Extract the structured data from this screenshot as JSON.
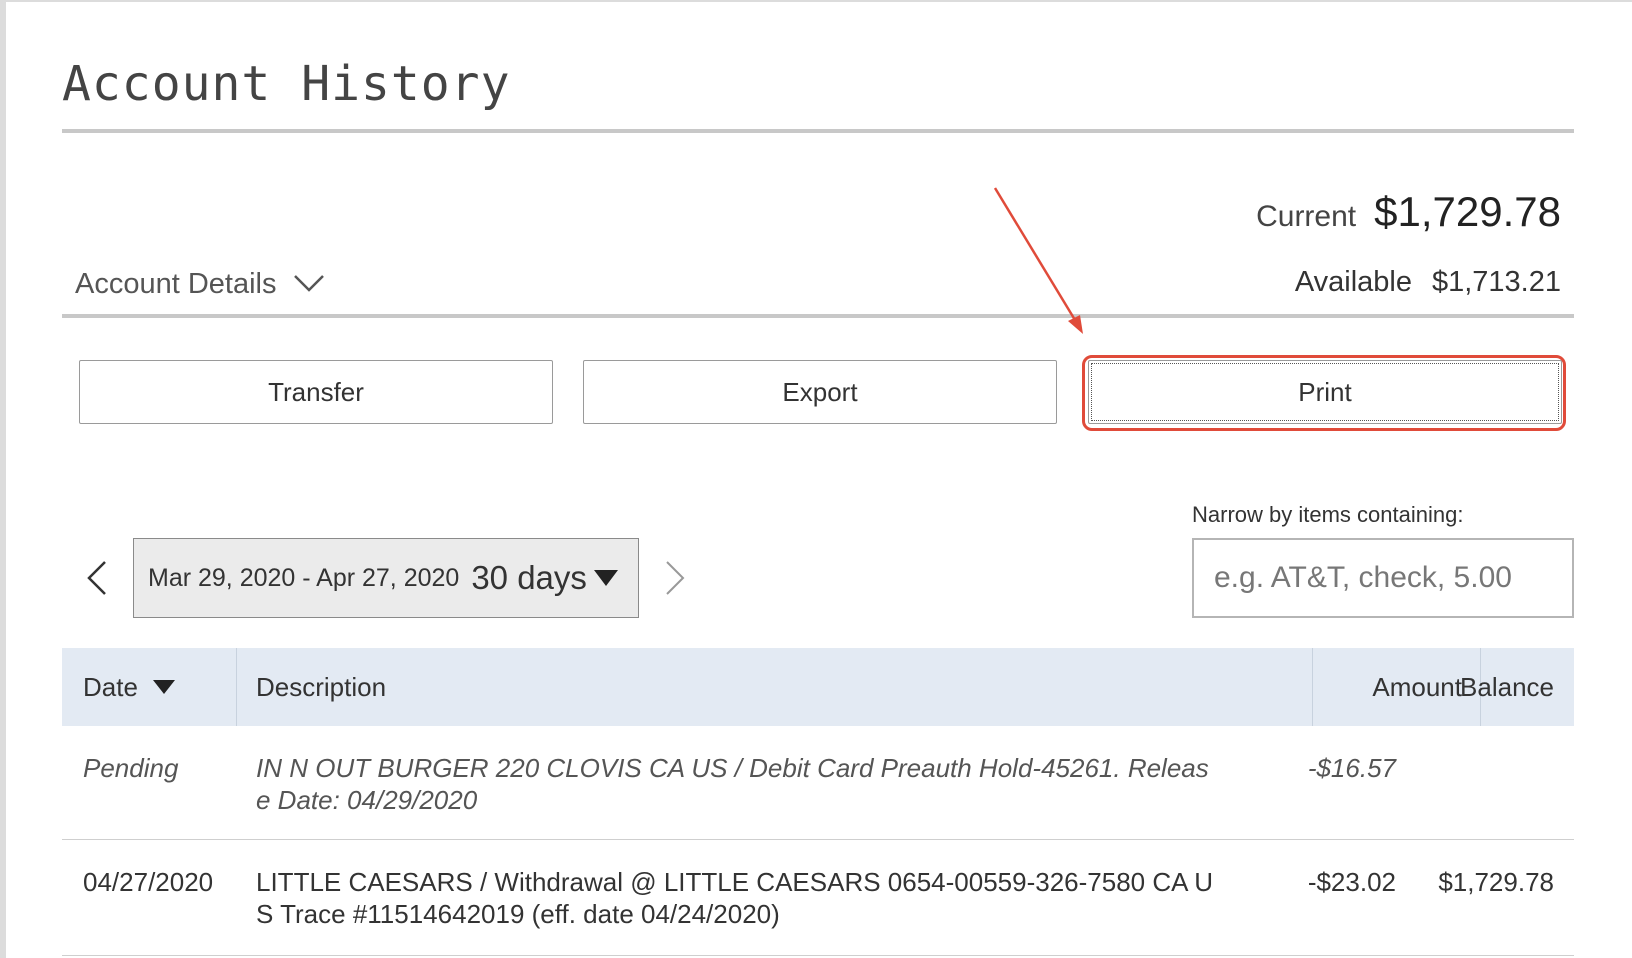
{
  "page": {
    "title": "Account History"
  },
  "account": {
    "details_label": "Account Details",
    "current_label": "Current",
    "current_value": "$1,729.78",
    "available_label": "Available",
    "available_value": "$1,713.21"
  },
  "actions": {
    "transfer_label": "Transfer",
    "export_label": "Export",
    "print_label": "Print"
  },
  "filter": {
    "date_range": "Mar 29, 2020 - Apr 27, 2020",
    "days": "30 days",
    "narrow_label": "Narrow by items containing:",
    "search_placeholder": "e.g. AT&T, check, 5.00"
  },
  "table": {
    "headers": {
      "date": "Date",
      "description": "Description",
      "amount": "Amount",
      "balance": "Balance"
    },
    "rows": [
      {
        "date": "Pending",
        "description": "IN N OUT BURGER 220 CLOVIS CA US / Debit Card Preauth Hold-45261. Release Date: 04/29/2020",
        "amount": "-$16.57",
        "balance": "",
        "pending": true
      },
      {
        "date": "04/27/2020",
        "description": "LITTLE CAESARS / Withdrawal @ LITTLE CAESARS 0654-00559-326-7580 CA US Trace #11514642019 (eff. date 04/24/2020)",
        "amount": "-$23.02",
        "balance": "$1,729.78",
        "pending": false
      }
    ]
  },
  "colors": {
    "highlight": "#e04b3a",
    "header_bg": "#e3eaf3",
    "rule": "#c8c8c8"
  },
  "icons": {
    "account_details": "chevron-down-icon",
    "prev": "chevron-left-icon",
    "next": "chevron-right-icon",
    "days_dropdown": "caret-down-icon",
    "date_sort": "sort-desc-icon"
  }
}
